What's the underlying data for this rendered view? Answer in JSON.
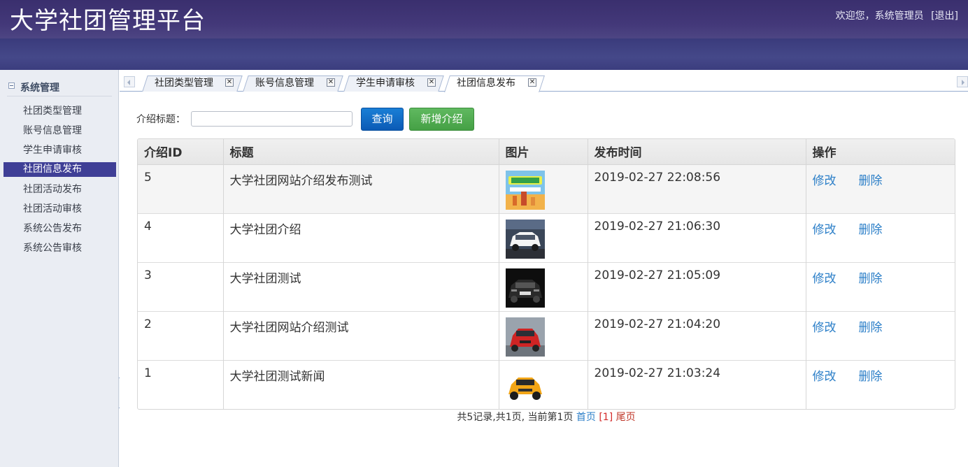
{
  "header": {
    "title": "大学社团管理平台",
    "welcome": "欢迎您，系统管理员",
    "logout": "[退出]"
  },
  "sidebar": {
    "group": "系统管理",
    "items": [
      {
        "label": "社团类型管理",
        "active": false
      },
      {
        "label": "账号信息管理",
        "active": false
      },
      {
        "label": "学生申请审核",
        "active": false
      },
      {
        "label": "社团信息发布",
        "active": true
      },
      {
        "label": "社团活动发布",
        "active": false
      },
      {
        "label": "社团活动审核",
        "active": false
      },
      {
        "label": "系统公告发布",
        "active": false
      },
      {
        "label": "系统公告审核",
        "active": false
      }
    ]
  },
  "tabs": [
    {
      "label": "社团类型管理",
      "active": false
    },
    {
      "label": "账号信息管理",
      "active": false
    },
    {
      "label": "学生申请审核",
      "active": false
    },
    {
      "label": "社团信息发布",
      "active": true
    }
  ],
  "search": {
    "label": "介绍标题：",
    "value": "",
    "query_button": "查询",
    "add_button": "新增介绍"
  },
  "table": {
    "headers": [
      "介绍ID",
      "标题",
      "图片",
      "发布时间",
      "操作"
    ],
    "rows": [
      {
        "id": "5",
        "title": "大学社团网站介绍发布测试",
        "image": "poster-thumb",
        "time": "2019-02-27 22:08:56"
      },
      {
        "id": "4",
        "title": "大学社团介绍",
        "image": "white-car-thumb",
        "time": "2019-02-27 21:06:30"
      },
      {
        "id": "3",
        "title": "大学社团测试",
        "image": "black-car-thumb",
        "time": "2019-02-27 21:05:09"
      },
      {
        "id": "2",
        "title": "大学社团网站介绍测试",
        "image": "red-car-thumb",
        "time": "2019-02-27 21:04:20"
      },
      {
        "id": "1",
        "title": "大学社团测试新闻",
        "image": "yellow-car-thumb",
        "time": "2019-02-27 21:03:24"
      }
    ],
    "edit_label": "修改",
    "delete_label": "删除"
  },
  "pager": {
    "summary": "共5记录,共1页, 当前第1页",
    "first": "首页",
    "current": "[1]",
    "last": "尾页"
  },
  "colors": {
    "header": "#433879",
    "active_nav": "#3f3f96",
    "query_button": "#0b5ab5",
    "add_button": "#45a045",
    "link": "#2c7fc8"
  }
}
